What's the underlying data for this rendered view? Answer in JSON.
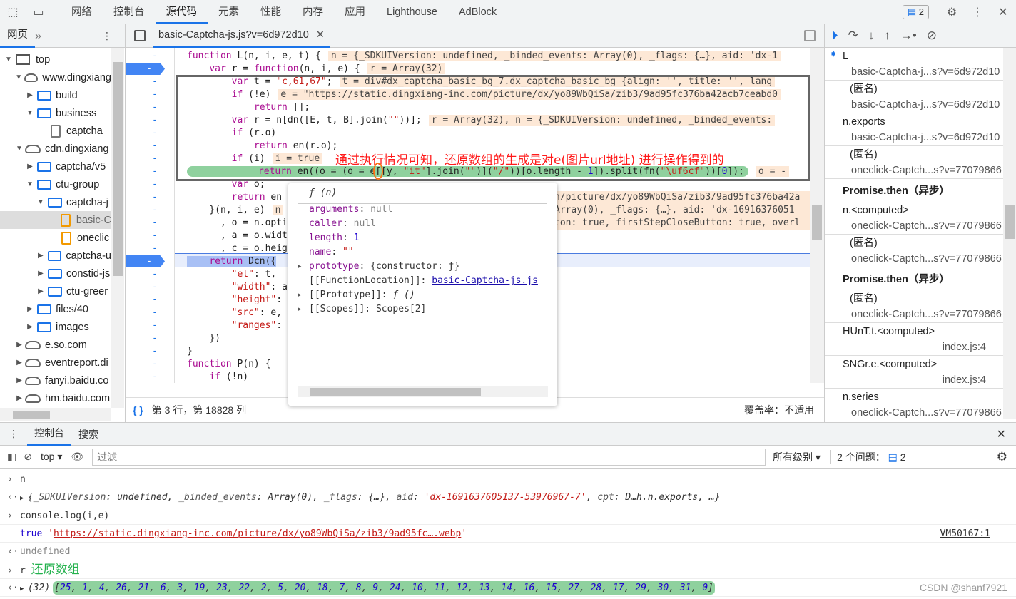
{
  "topbar": {
    "tabs": [
      "网络",
      "控制台",
      "源代码",
      "元素",
      "性能",
      "内存",
      "应用",
      "Lighthouse",
      "AdBlock"
    ],
    "active": 2,
    "issues_count": "2"
  },
  "navigator": {
    "tab": "网页",
    "more": "»"
  },
  "editor": {
    "file_tab": "basic-Captcha-js.js?v=6d972d10",
    "status_position": "第 3 行，第 18828 列",
    "coverage": "覆盖率：不适用"
  },
  "tree": [
    {
      "label": "top",
      "type": "frame",
      "depth": 0,
      "open": true
    },
    {
      "label": "www.dingxiang",
      "type": "cloud",
      "depth": 1,
      "open": true
    },
    {
      "label": "build",
      "type": "folder",
      "depth": 2,
      "open": false
    },
    {
      "label": "business",
      "type": "folder",
      "depth": 2,
      "open": true
    },
    {
      "label": "captcha",
      "type": "file",
      "depth": 3
    },
    {
      "label": "cdn.dingxiang",
      "type": "cloud",
      "depth": 1,
      "open": true
    },
    {
      "label": "captcha/v5",
      "type": "folder",
      "depth": 2,
      "open": false
    },
    {
      "label": "ctu-group",
      "type": "folder",
      "depth": 2,
      "open": true
    },
    {
      "label": "captcha-j",
      "type": "folder",
      "depth": 3,
      "open": true
    },
    {
      "label": "basic-C",
      "type": "js",
      "depth": 4,
      "selected": true
    },
    {
      "label": "oneclic",
      "type": "js",
      "depth": 4
    },
    {
      "label": "captcha-u",
      "type": "folder",
      "depth": 3,
      "open": false
    },
    {
      "label": "constid-js",
      "type": "folder",
      "depth": 3,
      "open": false
    },
    {
      "label": "ctu-greer",
      "type": "folder",
      "depth": 3,
      "open": false
    },
    {
      "label": "files/40",
      "type": "folder",
      "depth": 2,
      "open": false
    },
    {
      "label": "images",
      "type": "folder",
      "depth": 2,
      "open": false
    },
    {
      "label": "e.so.com",
      "type": "cloud",
      "depth": 1,
      "open": false
    },
    {
      "label": "eventreport.di",
      "type": "cloud",
      "depth": 1,
      "open": false
    },
    {
      "label": "fanyi.baidu.co",
      "type": "cloud",
      "depth": 1,
      "open": false
    },
    {
      "label": "hm.baidu.com",
      "type": "cloud",
      "depth": 1,
      "open": false
    }
  ],
  "code": [
    {
      "t": "function L(n, i, e, t) {",
      "a": "n = {_SDKUIVersion: undefined, _binded_events: Array(0), _flags: {…}, aid: 'dx-1"
    },
    {
      "t": "    var r = function(n, i, e) {",
      "a": "r = Array(32)",
      "bp": true
    },
    {
      "t": "        var t = \"c,61,67\";",
      "a": "t = div#dx_captcha_basic_bg_7.dx_captcha_basic_bg {align: '', title: '', lang"
    },
    {
      "t": "        if (!e)",
      "a": "e = \"https://static.dingxiang-inc.com/picture/dx/yo89WbQiSa/zib3/9ad95fc376ba42acb7ceabd0"
    },
    {
      "t": "            return [];"
    },
    {
      "t": "        var r = n[dn([E, t, B].join(\"\"))];",
      "a": "r = Array(32), n = {_SDKUIVersion: undefined, _binded_events:"
    },
    {
      "t": "        if (r.o)"
    },
    {
      "t": "            return en(r.o);"
    },
    {
      "t": "        if (i)",
      "a": "i = true"
    },
    {
      "t": "            return en((o = (o = e[[y, \"it\"].join(\"\")](\"/\"))[o.length - 1]).split(fn(\"\\uf6cf\"))[0]);",
      "a": "o = -",
      "green": true
    },
    {
      "t": "        var o;"
    },
    {
      "t": "        return en",
      "a2": "n/picture/dx/yo89WbQiSa/zib3/9ad95fc376ba42a"
    },
    {
      "t": "    }(n, i, e)",
      "a": "n",
      "a2": "Array(0), _flags: {…}, aid: 'dx-16916376051"
    },
    {
      "t": "      , o = n.opti",
      "a2": "ton: true, firstStepCloseButton: true, overl"
    },
    {
      "t": "      , a = o.widt"
    },
    {
      "t": "      , c = o.heig"
    },
    {
      "t": "    return Dcn({",
      "bp": true,
      "paused": true
    },
    {
      "t": "        \"el\": t,"
    },
    {
      "t": "        \"width\": a,"
    },
    {
      "t": "        \"height\": c,"
    },
    {
      "t": "        \"src\": e,"
    },
    {
      "t": "        \"ranges\":"
    },
    {
      "t": "    })"
    },
    {
      "t": "}"
    },
    {
      "t": "function P(n) {"
    },
    {
      "t": "    if (!n)"
    }
  ],
  "annotation": "通过执行情况可知，还原数组的生成是对e(图片url地址) 进行操作得到的",
  "tooltip": {
    "title": "ƒ (n)",
    "rows": [
      {
        "k": "arguments",
        "v": "null",
        "type": "null"
      },
      {
        "k": "caller",
        "v": "null",
        "type": "null"
      },
      {
        "k": "length",
        "v": "1",
        "type": "num"
      },
      {
        "k": "name",
        "v": "\"\"",
        "type": "str"
      },
      {
        "k": "prototype",
        "v": "{constructor: ƒ}",
        "type": "obj",
        "expand": true
      },
      {
        "k": "[[FunctionLocation]]",
        "v": "basic-Captcha-js.js",
        "type": "link"
      },
      {
        "k": "[[Prototype]]",
        "v": "ƒ ()",
        "type": "fn",
        "expand": true
      },
      {
        "k": "[[Scopes]]",
        "v": "Scopes[2]",
        "type": "obj",
        "expand": true
      }
    ]
  },
  "callstack": [
    {
      "fn": "L",
      "loc": "basic-Captcha-j...s?v=6d972d10",
      "current": true
    },
    {
      "fn": "(匿名)",
      "loc": "basic-Captcha-j...s?v=6d972d10"
    },
    {
      "fn": "n.exports",
      "loc": "basic-Captcha-j...s?v=6d972d10"
    },
    {
      "fn": "(匿名)",
      "loc": "oneclick-Captch...s?v=77079866"
    },
    {
      "async": "Promise.then（异步）"
    },
    {
      "fn": "n.<computed>",
      "loc": "oneclick-Captch...s?v=77079866"
    },
    {
      "fn": "(匿名)",
      "loc": "oneclick-Captch...s?v=77079866"
    },
    {
      "async": "Promise.then（异步）"
    },
    {
      "fn": "(匿名)",
      "loc": "oneclick-Captch...s?v=77079866"
    },
    {
      "fn": "HUnT.t.<computed>",
      "loc": "index.js:4",
      "right": true
    },
    {
      "fn": "SNGr.e.<computed>",
      "loc": "index.js:4",
      "right": true
    },
    {
      "fn": "n.series",
      "loc": "oneclick-Captch...s?v=77079866"
    }
  ],
  "drawer": {
    "tabs": [
      "控制台",
      "搜索"
    ],
    "context": "top",
    "filter_placeholder": "过滤",
    "levels": "所有级别",
    "issues": "2 个问题：",
    "issues_count": "2"
  },
  "console": {
    "in1": "n",
    "out1": {
      "pre": "{",
      "parts": [
        [
          "_SDKUIVersion",
          "undefined"
        ],
        [
          "_binded_events",
          "Array(0)"
        ],
        [
          "_flags",
          "{…}"
        ],
        [
          "aid",
          "'dx-1691637605137-53976967-7'"
        ],
        [
          "cpt",
          "D…h.n.exports"
        ]
      ],
      "post": ", …}"
    },
    "in2": "console.log(i,e)",
    "log_true": "true",
    "log_url": "https://static.dingxiang-inc.com/picture/dx/yo89WbQiSa/zib3/9ad95fc….webp",
    "log_src": "VM50167:1",
    "out2": "undefined",
    "in3": "r",
    "in3_note": "还原数组",
    "out3_len": "(32)",
    "out3": [
      25,
      1,
      4,
      26,
      21,
      6,
      3,
      19,
      23,
      22,
      2,
      5,
      20,
      18,
      7,
      8,
      9,
      24,
      10,
      11,
      12,
      13,
      14,
      16,
      15,
      27,
      28,
      17,
      29,
      30,
      31,
      0
    ]
  },
  "watermark": "CSDN @shanf7921",
  "colors": {
    "accent": "#1a73e8",
    "annotation": "#ff1a1a",
    "highlight": "#8fd19e",
    "inline_value_bg": "#fde8d6"
  }
}
